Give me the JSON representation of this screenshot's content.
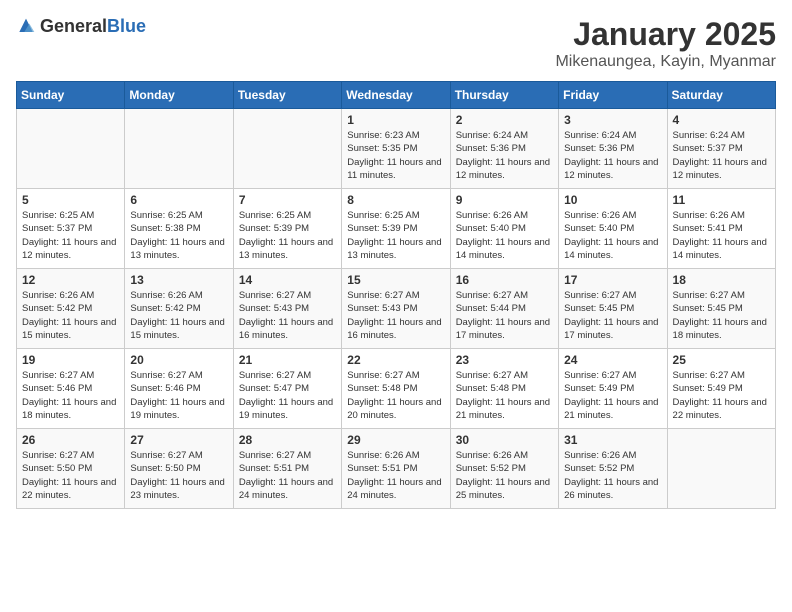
{
  "header": {
    "logo_general": "General",
    "logo_blue": "Blue",
    "month": "January 2025",
    "location": "Mikenaungea, Kayin, Myanmar"
  },
  "days_of_week": [
    "Sunday",
    "Monday",
    "Tuesday",
    "Wednesday",
    "Thursday",
    "Friday",
    "Saturday"
  ],
  "weeks": [
    [
      {
        "day": "",
        "sunrise": "",
        "sunset": "",
        "daylight": ""
      },
      {
        "day": "",
        "sunrise": "",
        "sunset": "",
        "daylight": ""
      },
      {
        "day": "",
        "sunrise": "",
        "sunset": "",
        "daylight": ""
      },
      {
        "day": "1",
        "sunrise": "Sunrise: 6:23 AM",
        "sunset": "Sunset: 5:35 PM",
        "daylight": "Daylight: 11 hours and 11 minutes."
      },
      {
        "day": "2",
        "sunrise": "Sunrise: 6:24 AM",
        "sunset": "Sunset: 5:36 PM",
        "daylight": "Daylight: 11 hours and 12 minutes."
      },
      {
        "day": "3",
        "sunrise": "Sunrise: 6:24 AM",
        "sunset": "Sunset: 5:36 PM",
        "daylight": "Daylight: 11 hours and 12 minutes."
      },
      {
        "day": "4",
        "sunrise": "Sunrise: 6:24 AM",
        "sunset": "Sunset: 5:37 PM",
        "daylight": "Daylight: 11 hours and 12 minutes."
      }
    ],
    [
      {
        "day": "5",
        "sunrise": "Sunrise: 6:25 AM",
        "sunset": "Sunset: 5:37 PM",
        "daylight": "Daylight: 11 hours and 12 minutes."
      },
      {
        "day": "6",
        "sunrise": "Sunrise: 6:25 AM",
        "sunset": "Sunset: 5:38 PM",
        "daylight": "Daylight: 11 hours and 13 minutes."
      },
      {
        "day": "7",
        "sunrise": "Sunrise: 6:25 AM",
        "sunset": "Sunset: 5:39 PM",
        "daylight": "Daylight: 11 hours and 13 minutes."
      },
      {
        "day": "8",
        "sunrise": "Sunrise: 6:25 AM",
        "sunset": "Sunset: 5:39 PM",
        "daylight": "Daylight: 11 hours and 13 minutes."
      },
      {
        "day": "9",
        "sunrise": "Sunrise: 6:26 AM",
        "sunset": "Sunset: 5:40 PM",
        "daylight": "Daylight: 11 hours and 14 minutes."
      },
      {
        "day": "10",
        "sunrise": "Sunrise: 6:26 AM",
        "sunset": "Sunset: 5:40 PM",
        "daylight": "Daylight: 11 hours and 14 minutes."
      },
      {
        "day": "11",
        "sunrise": "Sunrise: 6:26 AM",
        "sunset": "Sunset: 5:41 PM",
        "daylight": "Daylight: 11 hours and 14 minutes."
      }
    ],
    [
      {
        "day": "12",
        "sunrise": "Sunrise: 6:26 AM",
        "sunset": "Sunset: 5:42 PM",
        "daylight": "Daylight: 11 hours and 15 minutes."
      },
      {
        "day": "13",
        "sunrise": "Sunrise: 6:26 AM",
        "sunset": "Sunset: 5:42 PM",
        "daylight": "Daylight: 11 hours and 15 minutes."
      },
      {
        "day": "14",
        "sunrise": "Sunrise: 6:27 AM",
        "sunset": "Sunset: 5:43 PM",
        "daylight": "Daylight: 11 hours and 16 minutes."
      },
      {
        "day": "15",
        "sunrise": "Sunrise: 6:27 AM",
        "sunset": "Sunset: 5:43 PM",
        "daylight": "Daylight: 11 hours and 16 minutes."
      },
      {
        "day": "16",
        "sunrise": "Sunrise: 6:27 AM",
        "sunset": "Sunset: 5:44 PM",
        "daylight": "Daylight: 11 hours and 17 minutes."
      },
      {
        "day": "17",
        "sunrise": "Sunrise: 6:27 AM",
        "sunset": "Sunset: 5:45 PM",
        "daylight": "Daylight: 11 hours and 17 minutes."
      },
      {
        "day": "18",
        "sunrise": "Sunrise: 6:27 AM",
        "sunset": "Sunset: 5:45 PM",
        "daylight": "Daylight: 11 hours and 18 minutes."
      }
    ],
    [
      {
        "day": "19",
        "sunrise": "Sunrise: 6:27 AM",
        "sunset": "Sunset: 5:46 PM",
        "daylight": "Daylight: 11 hours and 18 minutes."
      },
      {
        "day": "20",
        "sunrise": "Sunrise: 6:27 AM",
        "sunset": "Sunset: 5:46 PM",
        "daylight": "Daylight: 11 hours and 19 minutes."
      },
      {
        "day": "21",
        "sunrise": "Sunrise: 6:27 AM",
        "sunset": "Sunset: 5:47 PM",
        "daylight": "Daylight: 11 hours and 19 minutes."
      },
      {
        "day": "22",
        "sunrise": "Sunrise: 6:27 AM",
        "sunset": "Sunset: 5:48 PM",
        "daylight": "Daylight: 11 hours and 20 minutes."
      },
      {
        "day": "23",
        "sunrise": "Sunrise: 6:27 AM",
        "sunset": "Sunset: 5:48 PM",
        "daylight": "Daylight: 11 hours and 21 minutes."
      },
      {
        "day": "24",
        "sunrise": "Sunrise: 6:27 AM",
        "sunset": "Sunset: 5:49 PM",
        "daylight": "Daylight: 11 hours and 21 minutes."
      },
      {
        "day": "25",
        "sunrise": "Sunrise: 6:27 AM",
        "sunset": "Sunset: 5:49 PM",
        "daylight": "Daylight: 11 hours and 22 minutes."
      }
    ],
    [
      {
        "day": "26",
        "sunrise": "Sunrise: 6:27 AM",
        "sunset": "Sunset: 5:50 PM",
        "daylight": "Daylight: 11 hours and 22 minutes."
      },
      {
        "day": "27",
        "sunrise": "Sunrise: 6:27 AM",
        "sunset": "Sunset: 5:50 PM",
        "daylight": "Daylight: 11 hours and 23 minutes."
      },
      {
        "day": "28",
        "sunrise": "Sunrise: 6:27 AM",
        "sunset": "Sunset: 5:51 PM",
        "daylight": "Daylight: 11 hours and 24 minutes."
      },
      {
        "day": "29",
        "sunrise": "Sunrise: 6:26 AM",
        "sunset": "Sunset: 5:51 PM",
        "daylight": "Daylight: 11 hours and 24 minutes."
      },
      {
        "day": "30",
        "sunrise": "Sunrise: 6:26 AM",
        "sunset": "Sunset: 5:52 PM",
        "daylight": "Daylight: 11 hours and 25 minutes."
      },
      {
        "day": "31",
        "sunrise": "Sunrise: 6:26 AM",
        "sunset": "Sunset: 5:52 PM",
        "daylight": "Daylight: 11 hours and 26 minutes."
      },
      {
        "day": "",
        "sunrise": "",
        "sunset": "",
        "daylight": ""
      }
    ]
  ]
}
